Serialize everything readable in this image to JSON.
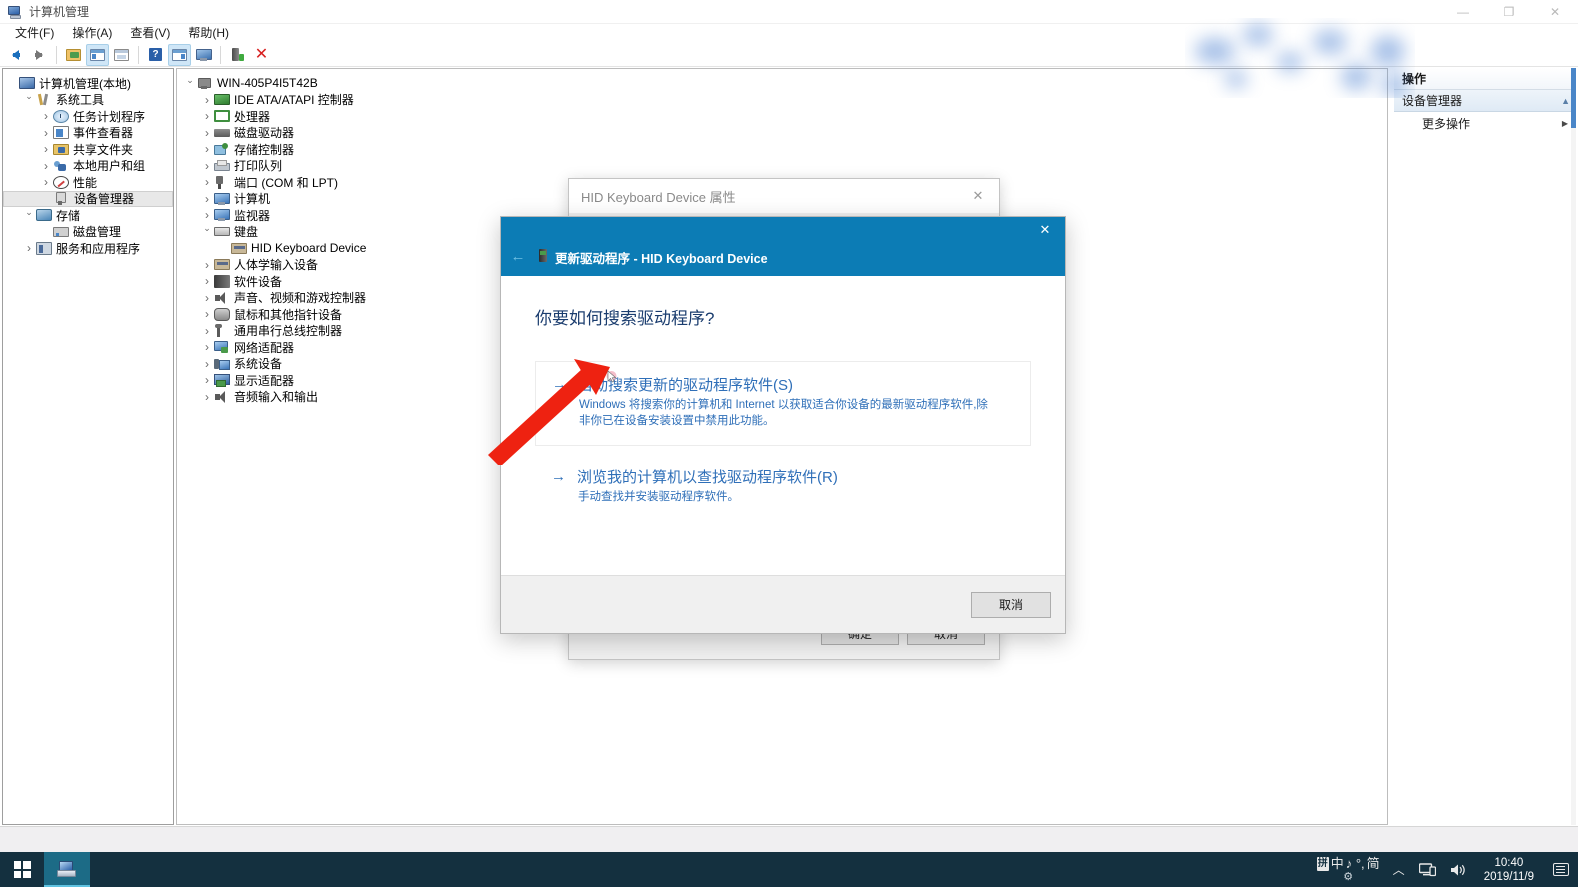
{
  "window": {
    "title": "计算机管理",
    "controls": {
      "minimize": "—",
      "maximize": "❐",
      "close": "✕"
    }
  },
  "menubar": {
    "items": [
      {
        "label": "文件(F)",
        "name": "menu-file"
      },
      {
        "label": "操作(A)",
        "name": "menu-action"
      },
      {
        "label": "查看(V)",
        "name": "menu-view"
      },
      {
        "label": "帮助(H)",
        "name": "menu-help"
      }
    ]
  },
  "toolbar": {
    "buttons": [
      {
        "name": "back-icon",
        "icon": "arrow-left"
      },
      {
        "name": "forward-icon",
        "icon": "arrow-right"
      },
      {
        "name": "up-folder-icon",
        "icon": "folder"
      },
      {
        "name": "show-console-tree-icon",
        "icon": "panel-left",
        "selected": true
      },
      {
        "name": "properties-icon",
        "icon": "panel-plain"
      },
      {
        "name": "help-icon",
        "icon": "help"
      },
      {
        "name": "show-action-pane-icon",
        "icon": "panel-right",
        "selected": true
      },
      {
        "name": "scan-hardware-icon",
        "icon": "monitor"
      },
      {
        "name": "update-driver-icon",
        "icon": "device"
      },
      {
        "name": "uninstall-device-icon",
        "icon": "red-x"
      }
    ]
  },
  "sidebar": {
    "items": [
      {
        "label": "计算机管理(本地)",
        "indent": 0,
        "chevron": "none",
        "icon": "pcmgr",
        "selected": false
      },
      {
        "label": "系统工具",
        "indent": 1,
        "chevron": "down",
        "icon": "tools",
        "selected": false
      },
      {
        "label": "任务计划程序",
        "indent": 2,
        "chevron": "right",
        "icon": "clock",
        "selected": false
      },
      {
        "label": "事件查看器",
        "indent": 2,
        "chevron": "right",
        "icon": "event",
        "selected": false
      },
      {
        "label": "共享文件夹",
        "indent": 2,
        "chevron": "right",
        "icon": "share",
        "selected": false
      },
      {
        "label": "本地用户和组",
        "indent": 2,
        "chevron": "right",
        "icon": "users",
        "selected": false
      },
      {
        "label": "性能",
        "indent": 2,
        "chevron": "right",
        "icon": "perf",
        "selected": false
      },
      {
        "label": "设备管理器",
        "indent": 2,
        "chevron": "none",
        "icon": "devmgr",
        "selected": true
      },
      {
        "label": "存储",
        "indent": 1,
        "chevron": "down",
        "icon": "storage",
        "selected": false
      },
      {
        "label": "磁盘管理",
        "indent": 2,
        "chevron": "none",
        "icon": "disk",
        "selected": false
      },
      {
        "label": "服务和应用程序",
        "indent": 1,
        "chevron": "right",
        "icon": "services",
        "selected": false
      }
    ]
  },
  "device_tree": {
    "items": [
      {
        "label": "WIN-405P4I5T42B",
        "indent": 0,
        "chevron": "down",
        "icon": "comp"
      },
      {
        "label": "IDE ATA/ATAPI 控制器",
        "indent": 1,
        "chevron": "right",
        "icon": "ide"
      },
      {
        "label": "处理器",
        "indent": 1,
        "chevron": "right",
        "icon": "cpu"
      },
      {
        "label": "磁盘驱动器",
        "indent": 1,
        "chevron": "right",
        "icon": "hdd"
      },
      {
        "label": "存储控制器",
        "indent": 1,
        "chevron": "right",
        "icon": "storctrl"
      },
      {
        "label": "打印队列",
        "indent": 1,
        "chevron": "right",
        "icon": "print"
      },
      {
        "label": "端口 (COM 和 LPT)",
        "indent": 1,
        "chevron": "right",
        "icon": "port"
      },
      {
        "label": "计算机",
        "indent": 1,
        "chevron": "right",
        "icon": "monitor2"
      },
      {
        "label": "监视器",
        "indent": 1,
        "chevron": "right",
        "icon": "monitor2"
      },
      {
        "label": "键盘",
        "indent": 1,
        "chevron": "down",
        "icon": "keyboard"
      },
      {
        "label": "HID Keyboard Device",
        "indent": 2,
        "chevron": "none",
        "icon": "hid"
      },
      {
        "label": "人体学输入设备",
        "indent": 1,
        "chevron": "right",
        "icon": "hid"
      },
      {
        "label": "软件设备",
        "indent": 1,
        "chevron": "right",
        "icon": "sw"
      },
      {
        "label": "声音、视频和游戏控制器",
        "indent": 1,
        "chevron": "right",
        "icon": "sound"
      },
      {
        "label": "鼠标和其他指针设备",
        "indent": 1,
        "chevron": "right",
        "icon": "mouse"
      },
      {
        "label": "通用串行总线控制器",
        "indent": 1,
        "chevron": "right",
        "icon": "usb"
      },
      {
        "label": "网络适配器",
        "indent": 1,
        "chevron": "right",
        "icon": "net"
      },
      {
        "label": "系统设备",
        "indent": 1,
        "chevron": "right",
        "icon": "sysdev"
      },
      {
        "label": "显示适配器",
        "indent": 1,
        "chevron": "right",
        "icon": "disp"
      },
      {
        "label": "音频输入和输出",
        "indent": 1,
        "chevron": "right",
        "icon": "sound"
      }
    ]
  },
  "actions_pane": {
    "header": "操作",
    "group": "设备管理器",
    "collapse_glyph": "▲",
    "items": [
      {
        "label": "更多操作",
        "submenu_glyph": "▶"
      }
    ]
  },
  "properties_window": {
    "title": "HID Keyboard Device 属性",
    "close_glyph": "✕",
    "ok_label": "确定",
    "cancel_label": "取消"
  },
  "wizard": {
    "header_title": "更新驱动程序 - HID Keyboard Device",
    "back_glyph": "←",
    "close_glyph": "✕",
    "heading": "你要如何搜索驱动程序?",
    "options": [
      {
        "arrow": "→",
        "title": "自动搜索更新的驱动程序软件(S)",
        "desc": "Windows 将搜索你的计算机和 Internet 以获取适合你设备的最新驱动程序软件,除非你已在设备安装设置中禁用此功能。",
        "boxed": true
      },
      {
        "arrow": "→",
        "title": "浏览我的计算机以查找驱动程序软件(R)",
        "desc": "手动查找并安装驱动程序软件。",
        "boxed": false
      }
    ],
    "cancel_label": "取消",
    "header_color": "#0c7cb5",
    "link_color": "#2f6fb8"
  },
  "annotation": {
    "arrow_color": "#ee2211",
    "description": "红色箭头指向自动搜索选项"
  },
  "taskbar": {
    "start_name": "start-button",
    "apps": [
      {
        "name": "taskbar-computer-management",
        "active": true
      }
    ],
    "ime": {
      "badge": "拼",
      "mode": "中",
      "glyphs": "♪ °,",
      "script": "简",
      "gear": "⚙"
    },
    "tray": {
      "chevron": "︿",
      "network_icon": "network-icon",
      "volume_icon": "volume-icon"
    },
    "clock": {
      "time": "10:40",
      "date": "2019/11/9"
    },
    "notification_icon": "action-center-icon"
  }
}
